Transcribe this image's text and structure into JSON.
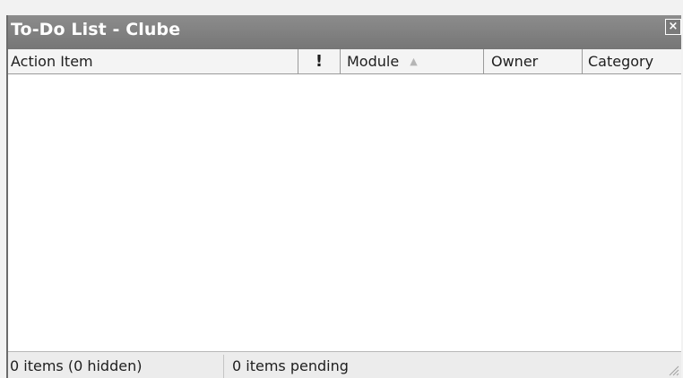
{
  "window": {
    "title": "To-Do List - Clube",
    "close_label": "×"
  },
  "columns": {
    "action_item": "Action Item",
    "priority": "!",
    "module": "Module",
    "module_sort_icon": "▲",
    "owner": "Owner",
    "category": "Category"
  },
  "status": {
    "items": "0 items (0 hidden)",
    "pending": "0 items pending"
  },
  "icons": {
    "close": "close-icon",
    "sort_ascending": "sort-ascending-icon",
    "resize_grip": "resize-grip-icon"
  }
}
